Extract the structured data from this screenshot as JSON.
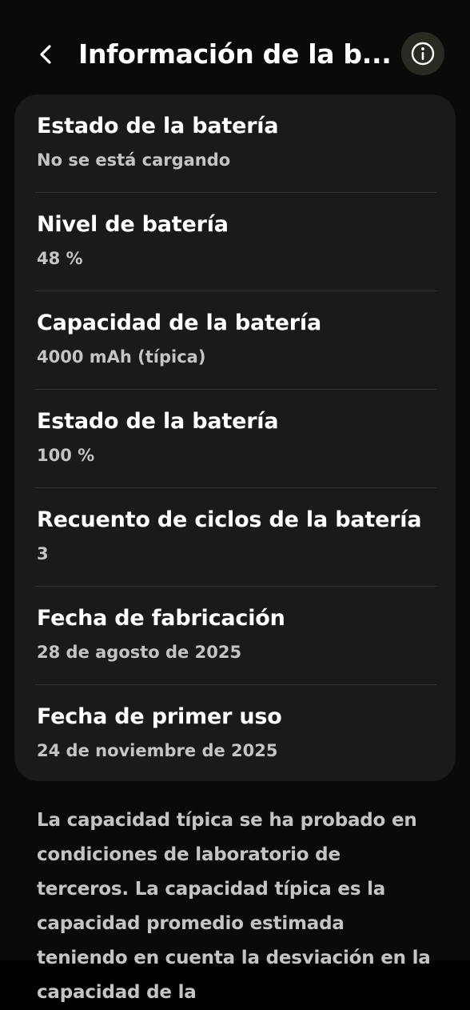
{
  "header": {
    "title": "Información de la b..."
  },
  "battery_info": {
    "items": [
      {
        "title": "Estado de la batería",
        "value": "No se está cargando"
      },
      {
        "title": "Nivel de batería",
        "value": "48 %"
      },
      {
        "title": "Capacidad de la batería",
        "value": "4000 mAh (típica)"
      },
      {
        "title": "Estado de la batería",
        "value": "100 %"
      },
      {
        "title": "Recuento de ciclos de la batería",
        "value": "3"
      },
      {
        "title": "Fecha de fabricación",
        "value": "28 de agosto de 2025"
      },
      {
        "title": "Fecha de primer uso",
        "value": "24 de noviembre de 2025"
      }
    ]
  },
  "footnote": {
    "text": "La capacidad típica se ha probado en condiciones de laboratorio de terceros. La capacidad típica es la capacidad promedio estimada teniendo en cuenta la desviación en la capacidad de la"
  },
  "colors": {
    "background": "#0a0a0a",
    "card": "#1a1a1a",
    "primary_text": "#ffffff",
    "secondary_text": "#c4c4c4",
    "info_button_bg": "#2a2a22"
  },
  "icons": {
    "back": "chevron-left-icon",
    "info": "info-circle-icon"
  }
}
